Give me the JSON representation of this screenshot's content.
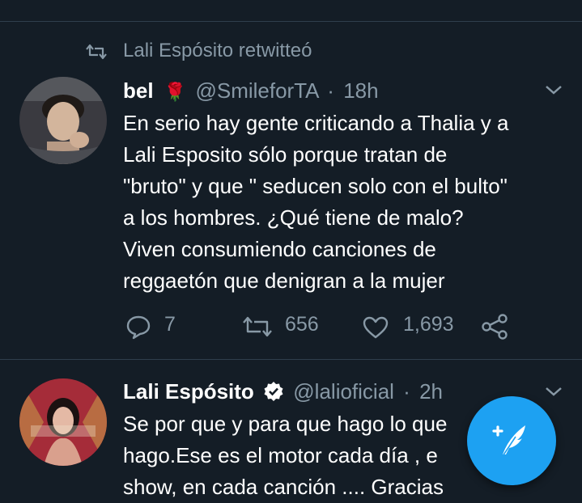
{
  "top_action_row": {
    "icons": [
      "reply-icon",
      "retweet-icon",
      "like-icon",
      "share-icon"
    ]
  },
  "retweet_context": {
    "icon": "retweet-icon",
    "text": "Lali Espósito retwitteó"
  },
  "tweet1": {
    "display_name": "bel",
    "emoji": "🌹",
    "handle": "@SmileforTA",
    "separator": "·",
    "time": "18h",
    "lines": [
      "En serio hay gente criticando a Thalia y a",
      "Lali Esposito sólo porque tratan de",
      "\"bruto\" y que \" seducen solo con el bulto\"",
      "a los hombres. ¿Qué tiene de malo?",
      "Viven consumiendo canciones de",
      "reggaetón que denigran a la mujer"
    ],
    "reply_count": "7",
    "retweet_count": "656",
    "like_count": "1,693"
  },
  "tweet2": {
    "display_name": "Lali Espósito",
    "verified": true,
    "handle": "@lalioficial",
    "separator": "·",
    "time": "2h",
    "lines": [
      "Se por que  y para que hago lo que",
      "hago.Ese es el motor cada día , e",
      "show, en cada canción .... Gracias"
    ]
  },
  "fab": {
    "icon": "compose-feather-icon"
  },
  "colors": {
    "background": "#141d26",
    "divider": "#2f3e4c",
    "muted_text": "#8899a6",
    "accent": "#1da1f2"
  }
}
